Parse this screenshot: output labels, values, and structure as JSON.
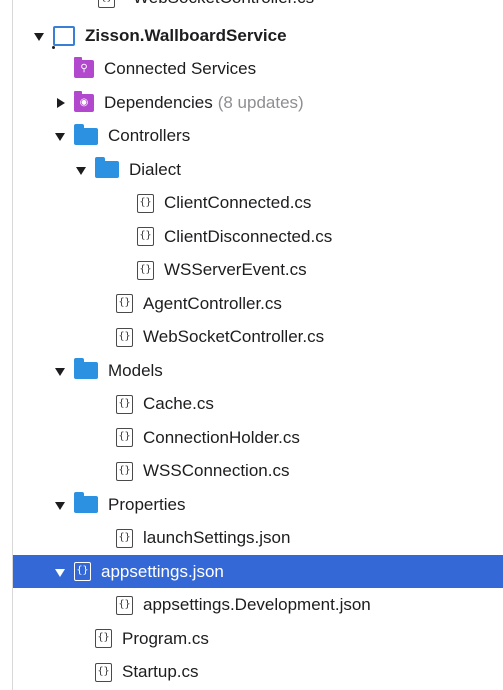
{
  "partial_row": {
    "label": "WebSocketController.cs"
  },
  "tree": [
    {
      "id": "project",
      "label": "Zisson.WallboardService",
      "bold": true,
      "disclosure": "down",
      "icon": "project-icon",
      "indent": 0
    },
    {
      "id": "connected-services",
      "label": "Connected Services",
      "disclosure": "none",
      "icon": "connected-services-icon",
      "indent": 1
    },
    {
      "id": "dependencies",
      "label": "Dependencies",
      "suffix": "(8 updates)",
      "disclosure": "right",
      "icon": "dependencies-icon",
      "indent": 1
    },
    {
      "id": "controllers",
      "label": "Controllers",
      "disclosure": "down",
      "icon": "folder-icon",
      "indent": 1
    },
    {
      "id": "dialect",
      "label": "Dialect",
      "disclosure": "down",
      "icon": "folder-icon",
      "indent": 2
    },
    {
      "id": "client-connected",
      "label": "ClientConnected.cs",
      "disclosure": "none",
      "icon": "file-icon",
      "indent": 4
    },
    {
      "id": "client-disconnected",
      "label": "ClientDisconnected.cs",
      "disclosure": "none",
      "icon": "file-icon",
      "indent": 4
    },
    {
      "id": "wsserver-event",
      "label": "WSServerEvent.cs",
      "disclosure": "none",
      "icon": "file-icon",
      "indent": 4
    },
    {
      "id": "agent-controller",
      "label": "AgentController.cs",
      "disclosure": "none",
      "icon": "file-icon",
      "indent": 3
    },
    {
      "id": "websocket-controller",
      "label": "WebSocketController.cs",
      "disclosure": "none",
      "icon": "file-icon",
      "indent": 3
    },
    {
      "id": "models",
      "label": "Models",
      "disclosure": "down",
      "icon": "folder-icon",
      "indent": 1
    },
    {
      "id": "cache",
      "label": "Cache.cs",
      "disclosure": "none",
      "icon": "file-icon",
      "indent": 3
    },
    {
      "id": "connection-holder",
      "label": "ConnectionHolder.cs",
      "disclosure": "none",
      "icon": "file-icon",
      "indent": 3
    },
    {
      "id": "wss-connection",
      "label": "WSSConnection.cs",
      "disclosure": "none",
      "icon": "file-icon",
      "indent": 3
    },
    {
      "id": "properties",
      "label": "Properties",
      "disclosure": "down",
      "icon": "folder-icon",
      "indent": 1
    },
    {
      "id": "launch-settings",
      "label": "launchSettings.json",
      "disclosure": "none",
      "icon": "file-icon",
      "indent": 3
    },
    {
      "id": "appsettings",
      "label": "appsettings.json",
      "disclosure": "down",
      "icon": "file-icon",
      "indent": 1,
      "selected": true
    },
    {
      "id": "appsettings-dev",
      "label": "appsettings.Development.json",
      "disclosure": "none",
      "icon": "file-icon",
      "indent": 3
    },
    {
      "id": "program",
      "label": "Program.cs",
      "disclosure": "none",
      "icon": "file-icon",
      "indent": 2
    },
    {
      "id": "startup",
      "label": "Startup.cs",
      "disclosure": "none",
      "icon": "file-icon",
      "indent": 2
    }
  ],
  "colors": {
    "selection": "#3468d6",
    "folder": "#2c91e0",
    "special_folder": "#b148cd"
  }
}
